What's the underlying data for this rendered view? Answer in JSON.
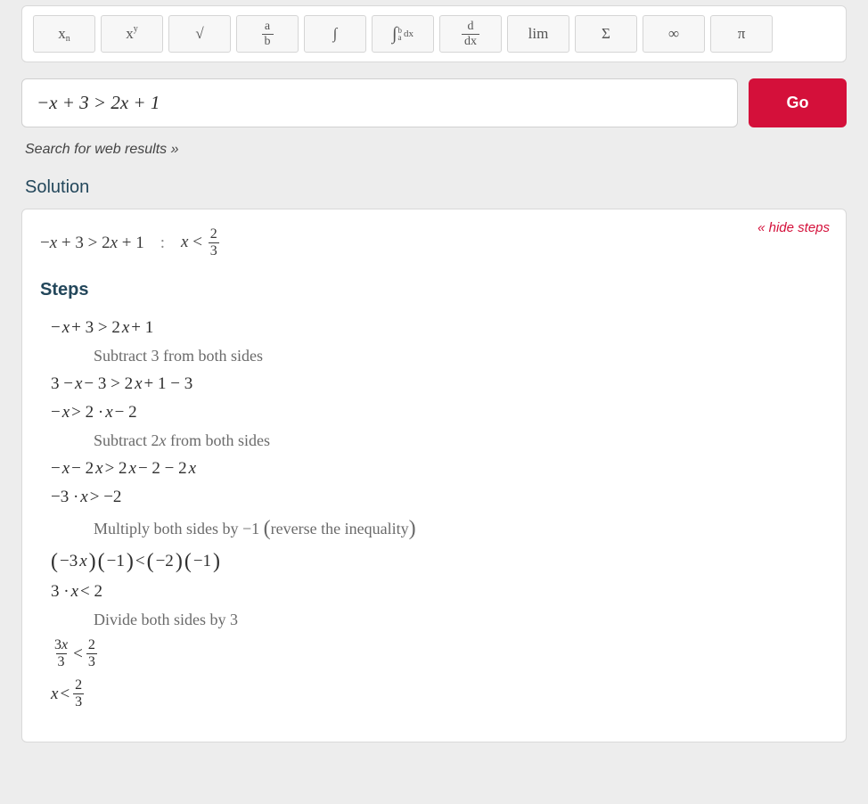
{
  "toolbar": {
    "keys": [
      {
        "id": "subscript",
        "label_html": "x<sub>n</sub>"
      },
      {
        "id": "superscript",
        "label_html": "x<sup>y</sup>"
      },
      {
        "id": "sqrt",
        "label_text": "√"
      },
      {
        "id": "fraction",
        "frac": {
          "num": "a",
          "den": "b"
        }
      },
      {
        "id": "integral",
        "label_text": "∫"
      },
      {
        "id": "def-integral",
        "defint": {
          "upper": "b",
          "lower": "a",
          "dx": "dx"
        }
      },
      {
        "id": "derivative",
        "frac": {
          "num": "d",
          "den": "dx"
        }
      },
      {
        "id": "limit",
        "label_text": "lim"
      },
      {
        "id": "sum",
        "label_text": "Σ"
      },
      {
        "id": "infinity",
        "label_text": "∞"
      },
      {
        "id": "pi",
        "label_text": "π"
      }
    ]
  },
  "search": {
    "value": "−x + 3 > 2x + 1",
    "go_label": "Go"
  },
  "web_results_link": "Search for web results »",
  "solution_title": "Solution",
  "hide_steps_label": "« hide steps",
  "summary": {
    "problem": "−x + 3 > 2x + 1",
    "answer_prefix": "x <",
    "answer_frac": {
      "num": "2",
      "den": "3"
    }
  },
  "steps_heading": "Steps",
  "steps": [
    {
      "type": "expr",
      "text": "−x + 3 > 2x + 1"
    },
    {
      "type": "explain",
      "text": "Subtract 3 from both sides"
    },
    {
      "type": "expr",
      "text": "3 − x − 3 > 2x + 1 − 3"
    },
    {
      "type": "expr",
      "text": "−x > 2 · x − 2"
    },
    {
      "type": "explain",
      "text": "Subtract 2x from both sides"
    },
    {
      "type": "expr",
      "text": "−x − 2x > 2x − 2 − 2x"
    },
    {
      "type": "expr",
      "text": "−3 · x > −2"
    },
    {
      "type": "explain",
      "text": "Multiply both sides by −1 (reverse the inequality)"
    },
    {
      "type": "expr",
      "text": "(−3x)(−1) < (−2)(−1)"
    },
    {
      "type": "expr",
      "text": "3 · x < 2"
    },
    {
      "type": "explain",
      "text": "Divide both sides by 3"
    },
    {
      "type": "fracrow",
      "left": {
        "num": "3x",
        "den": "3"
      },
      "op": "<",
      "right": {
        "num": "2",
        "den": "3"
      }
    },
    {
      "type": "answer",
      "prefix": "x <",
      "frac": {
        "num": "2",
        "den": "3"
      }
    }
  ]
}
